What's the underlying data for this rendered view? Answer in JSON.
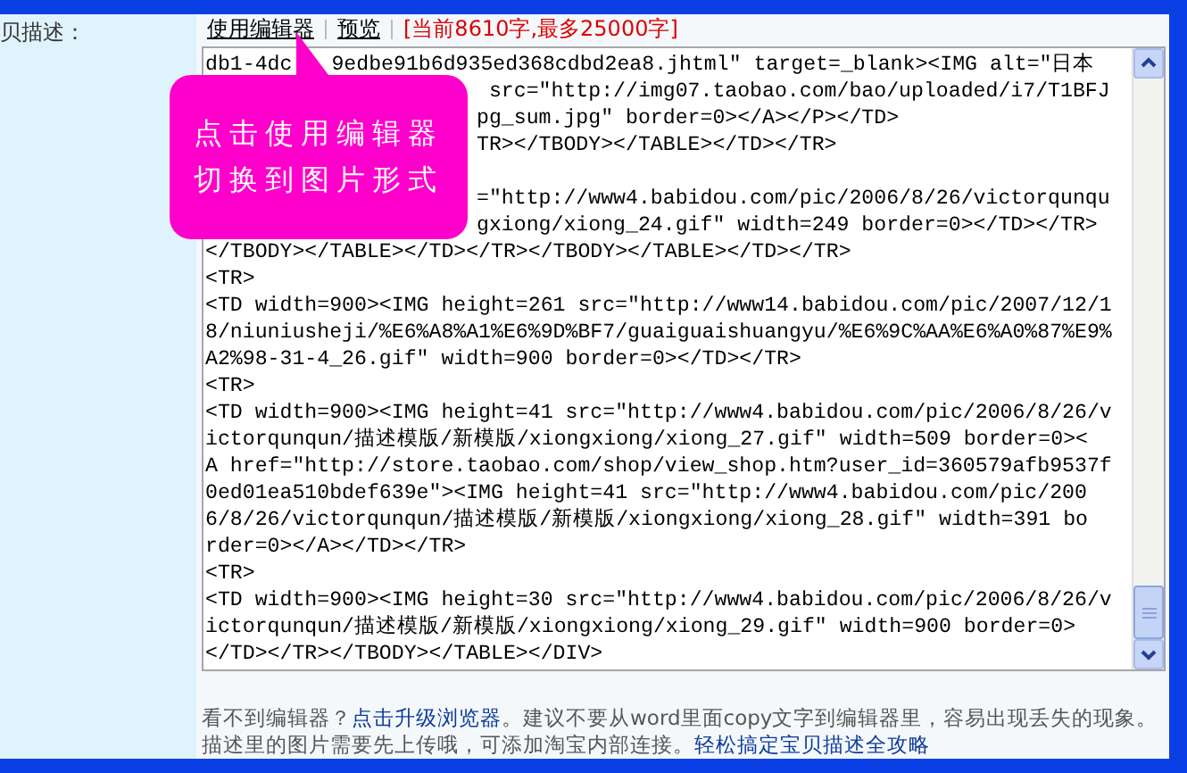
{
  "field_label": "贝描述：",
  "toolbar": {
    "editor_link": "使用编辑器",
    "preview_link": "预览",
    "counter": "[当前8610字,最多25000字]"
  },
  "callout": {
    "lines": [
      "点击使用编辑器",
      "切换到图片形式"
    ]
  },
  "source_lines": [
    {
      "kind": "split",
      "segments": [
        "db1-4dc",
        "9edbe91b6d935ed368cdbd2ea8.jhtml\" target=_blank><IMG alt=\"日本"
      ]
    },
    {
      "kind": "partial",
      "text": " src=\"http://img07.taobao.com/bao/uploaded/i7/T1BFJ"
    },
    {
      "kind": "partial",
      "text": "pg_sum.jpg\" border=0></A></P></TD>"
    },
    {
      "kind": "partial",
      "text": "TR></TBODY></TABLE></TD></TR>"
    },
    {
      "kind": "hidden"
    },
    {
      "kind": "partial",
      "text": "=\"http://www4.babidou.com/pic/2006/8/26/victorqunqu"
    },
    {
      "kind": "partial",
      "text": "gxiong/xiong_24.gif\" width=249 border=0></TD></TR>"
    },
    {
      "kind": "full",
      "text": "</TBODY></TABLE></TD></TR></TBODY></TABLE></TD></TR>"
    },
    {
      "kind": "full",
      "text": "<TR>"
    },
    {
      "kind": "full",
      "text": "<TD width=900><IMG height=261 src=\"http://www14.babidou.com/pic/2007/12/1"
    },
    {
      "kind": "full",
      "text": "8/niuniusheji/%E6%A8%A1%E6%9D%BF7/guaiguaishuangyu/%E6%9C%AA%E6%A0%87%E9%"
    },
    {
      "kind": "full",
      "text": "A2%98-31-4_26.gif\" width=900 border=0></TD></TR>"
    },
    {
      "kind": "full",
      "text": "<TR>"
    },
    {
      "kind": "full",
      "text": "<TD width=900><IMG height=41 src=\"http://www4.babidou.com/pic/2006/8/26/v"
    },
    {
      "kind": "full",
      "text": "ictorqunqun/描述模版/新模版/xiongxiong/xiong_27.gif\" width=509 border=0><"
    },
    {
      "kind": "full",
      "text": "A href=\"http://store.taobao.com/shop/view_shop.htm?user_id=360579afb9537f"
    },
    {
      "kind": "full",
      "text": "0ed01ea510bdef639e\"><IMG height=41 src=\"http://www4.babidou.com/pic/200"
    },
    {
      "kind": "full",
      "text": "6/8/26/victorqunqun/描述模版/新模版/xiongxiong/xiong_28.gif\" width=391 bo"
    },
    {
      "kind": "full",
      "text": "rder=0></A></TD></TR>"
    },
    {
      "kind": "full",
      "text": "<TR>"
    },
    {
      "kind": "full",
      "text": "<TD width=900><IMG height=30 src=\"http://www4.babidou.com/pic/2006/8/26/v"
    },
    {
      "kind": "full",
      "text": "ictorqunqun/描述模版/新模版/xiongxiong/xiong_29.gif\" width=900 border=0>"
    },
    {
      "kind": "full",
      "text": "</TD></TR></TBODY></TABLE></DIV>"
    }
  ],
  "notes": [
    {
      "before": "看不到编辑器？",
      "link": "点击升级浏览器",
      "after": "。建议不要从word里面copy文字到编辑器里，容易出现丢失的现象。"
    },
    {
      "before": "描述里的图片需要先上传哦，可添加淘宝内部连接。",
      "link": "轻松搞定宝贝描述全攻略"
    }
  ]
}
